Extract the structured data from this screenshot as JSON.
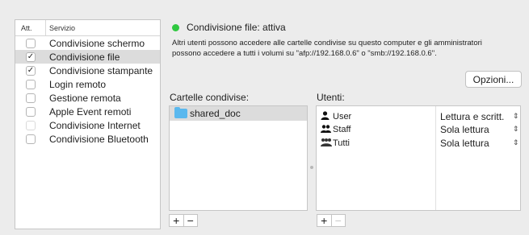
{
  "services": {
    "header_att": "Att.",
    "header_service": "Servizio",
    "items": [
      {
        "label": "Condivisione schermo",
        "checked": false
      },
      {
        "label": "Condivisione file",
        "checked": true,
        "selected": true
      },
      {
        "label": "Condivisione stampante",
        "checked": true
      },
      {
        "label": "Login remoto",
        "checked": false
      },
      {
        "label": "Gestione remota",
        "checked": false
      },
      {
        "label": "Apple Event remoti",
        "checked": false
      },
      {
        "label": "Condivisione Internet",
        "checked": false,
        "disabled": true
      },
      {
        "label": "Condivisione Bluetooth",
        "checked": false
      }
    ]
  },
  "status": {
    "text": "Condivisione file: attiva",
    "color": "#2fc840"
  },
  "description": {
    "line1": "Altri utenti possono accedere alle cartelle condivise su questo computer e gli amministratori",
    "line2": "possono accedere a tutti i volumi su \"afp://192.168.0.6\" o \"smb://192.168.0.6\"."
  },
  "options_button": "Opzioni...",
  "shared_folders": {
    "label": "Cartelle condivise:",
    "items": [
      {
        "name": "shared_doc",
        "icon": "folder-icon"
      }
    ]
  },
  "users": {
    "label": "Utenti:",
    "items": [
      {
        "name": "User",
        "permission": "Lettura e scritt.",
        "icon": "single-user-icon"
      },
      {
        "name": "Staff",
        "permission": "Sola lettura",
        "icon": "group-icon"
      },
      {
        "name": "Tutti",
        "permission": "Sola lettura",
        "icon": "everyone-icon"
      }
    ]
  },
  "plus_minus": {
    "plus": "+",
    "minus": "−"
  }
}
